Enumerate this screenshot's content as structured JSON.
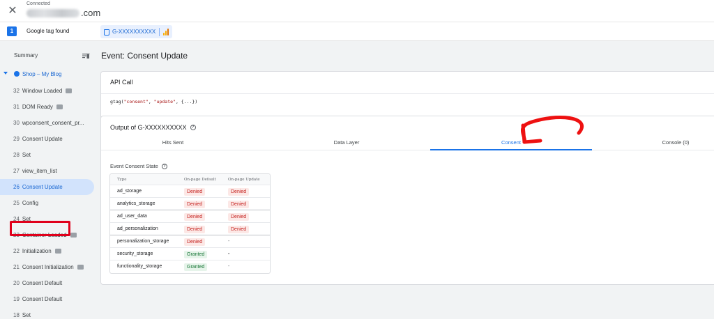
{
  "header": {
    "status_label": "Connected",
    "domain_suffix": ".com",
    "close_icon": "close-icon"
  },
  "tagbar": {
    "count": "1",
    "found_label": "Google tag found",
    "tag_id": "G-XXXXXXXXXX",
    "colors": {
      "accent": "#1a73e8",
      "analytics": "#f9ab00"
    }
  },
  "sidebar": {
    "summary_label": "Summary",
    "container_label": "Shop – My Blog",
    "events": [
      {
        "num": "32",
        "label": "Window Loaded",
        "badge": true
      },
      {
        "num": "31",
        "label": "DOM Ready",
        "badge": true
      },
      {
        "num": "30",
        "label": "wpconsent_consent_pr...",
        "badge": false
      },
      {
        "num": "29",
        "label": "Consent Update",
        "badge": false
      },
      {
        "num": "28",
        "label": "Set",
        "badge": false
      },
      {
        "num": "27",
        "label": "view_item_list",
        "badge": false
      },
      {
        "num": "26",
        "label": "Consent Update",
        "badge": false,
        "selected": true
      },
      {
        "num": "25",
        "label": "Config",
        "badge": false
      },
      {
        "num": "24",
        "label": "Set",
        "badge": false
      },
      {
        "num": "23",
        "label": "Container Loaded",
        "badge": true
      },
      {
        "num": "22",
        "label": "Initialization",
        "badge": true
      },
      {
        "num": "21",
        "label": "Consent Initialization",
        "badge": true
      },
      {
        "num": "20",
        "label": "Consent Default",
        "badge": false
      },
      {
        "num": "19",
        "label": "Consent Default",
        "badge": false
      },
      {
        "num": "18",
        "label": "Set",
        "badge": false
      }
    ]
  },
  "main": {
    "event_title": "Event: Consent Update",
    "api_call": {
      "title": "API Call",
      "code_fn": "gtag(",
      "code_arg1": "\"consent\"",
      "code_sep": ", ",
      "code_arg2": "\"update\"",
      "code_rest": ", {...})"
    },
    "output": {
      "title": "Output of G-XXXXXXXXXX",
      "tabs": [
        "Hits Sent",
        "Data Layer",
        "Consent",
        "Console (0)"
      ],
      "active_tab": "Consent",
      "section_label": "Event Consent State",
      "table": {
        "headers": [
          "Type",
          "On-page Default",
          "On-page Update"
        ],
        "rows": [
          {
            "type": "ad_storage",
            "default": "Denied",
            "update": "Denied"
          },
          {
            "type": "analytics_storage",
            "default": "Denied",
            "update": "Denied"
          },
          {
            "type": "ad_user_data",
            "default": "Denied",
            "update": "Denied"
          },
          {
            "type": "ad_personalization",
            "default": "Denied",
            "update": "Denied"
          },
          {
            "type": "personalization_storage",
            "default": "Denied",
            "update": "-"
          },
          {
            "type": "security_storage",
            "default": "Granted",
            "update": "-"
          },
          {
            "type": "functionality_storage",
            "default": "Granted",
            "update": "-"
          }
        ]
      }
    }
  },
  "annotations": {
    "highlight_color": "#e0001b"
  }
}
